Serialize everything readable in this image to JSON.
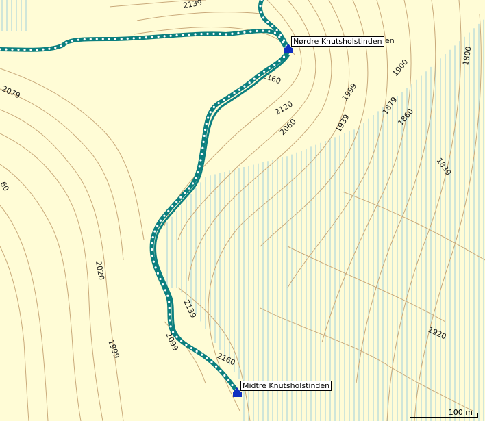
{
  "map": {
    "waypoints": [
      {
        "id": "nordre",
        "label": "Nørdre Knutsholstinden"
      },
      {
        "id": "midtre",
        "label": "Midtre Knutsholstinden"
      }
    ],
    "label_fragment": "en",
    "scale_label": "100 m",
    "contour_labels": [
      "2139",
      "2079",
      "60",
      "2020",
      "1999",
      "2099",
      "2139",
      "2160",
      "2160",
      "2120",
      "2060",
      "1939",
      "1999",
      "1900",
      "1879",
      "1860",
      "1800",
      "1839",
      "1920"
    ],
    "colors": {
      "background": "#fffcd6",
      "contour": "#c9a97a",
      "glacier": "#9fd0dc",
      "track": "#0b7f7f",
      "waypoint_icon": "#1030c0"
    }
  }
}
